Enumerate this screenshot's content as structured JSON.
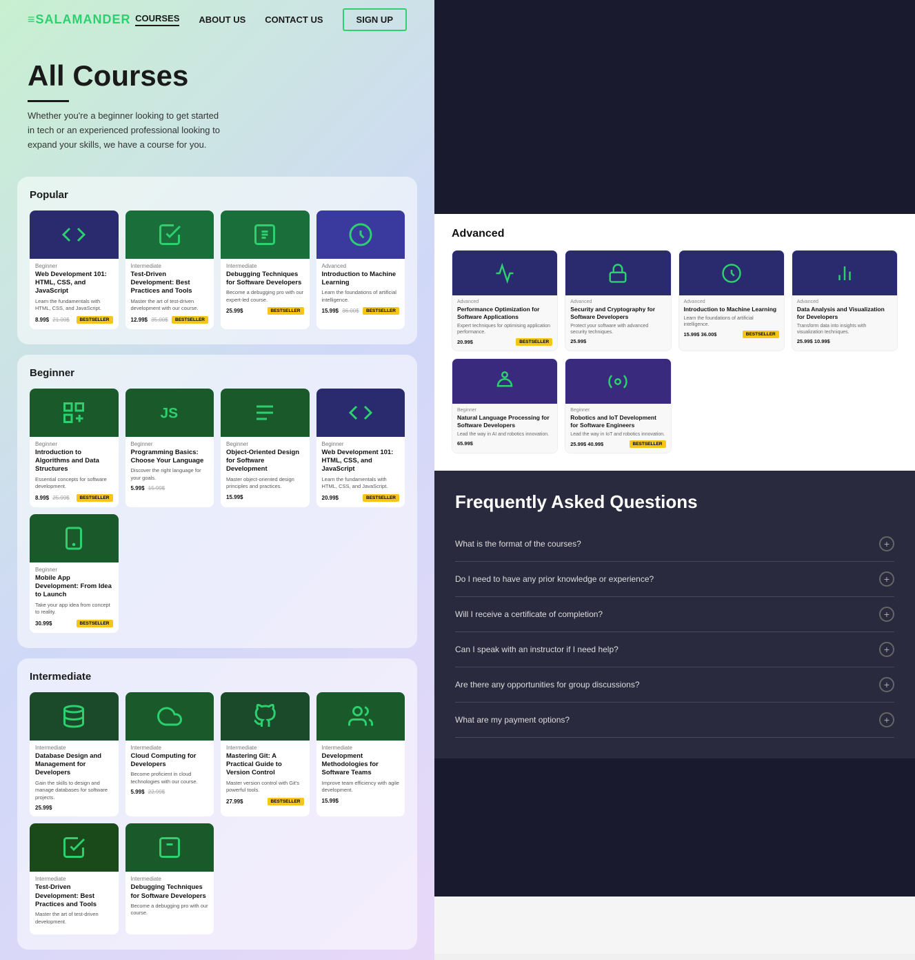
{
  "site": {
    "logo": "≡SALAMANDER",
    "logo_accent": "≡",
    "nav": {
      "courses": "COURSES",
      "about": "ABOUT US",
      "contact": "CONTACT US",
      "signup": "SIGN UP"
    }
  },
  "hero": {
    "title": "All Courses",
    "description": "Whether you're a beginner looking to get started in tech or an experienced professional looking to expand your skills, we have a course for you."
  },
  "popular": {
    "section_title": "Popular",
    "courses": [
      {
        "level": "Beginner",
        "title": "Web Development 101: HTML, CSS, and JavaScript",
        "desc": "Learn the fundamentals with HTML, CSS, and JavaScript.",
        "price": "8.99$",
        "old_price": "21.00$",
        "badge": "BESTSELLER",
        "thumb_color": "#1a3a1a"
      },
      {
        "level": "Intermediate",
        "title": "Test-Driven Development: Best Practices and Tools",
        "desc": "Master the art of test-driven development with our course.",
        "price": "12.99$",
        "old_price": "35.00$",
        "badge": "BESTSELLER",
        "thumb_color": "#1a4a1a"
      },
      {
        "level": "Intermediate",
        "title": "Debugging Techniques for Software Developers",
        "desc": "Become a debugging pro with our expert-led course.",
        "price": "25.99$",
        "old_price": "",
        "badge": "BESTSELLER",
        "thumb_color": "#1a4a1a"
      },
      {
        "level": "Advanced",
        "title": "Introduction to Machine Learning",
        "desc": "Learn the foundations of artificial intelligence.",
        "price": "15.99$",
        "old_price": "36.00$",
        "badge": "BESTSELLER",
        "thumb_color": "#2a2a7e"
      }
    ]
  },
  "beginner": {
    "section_title": "Beginner",
    "courses": [
      {
        "level": "Beginner",
        "title": "Introduction to Algorithms and Data Structures",
        "desc": "Essential concepts for software development.",
        "price": "8.99$",
        "old_price": "25.99$",
        "badge": "BESTSELLER",
        "thumb_color": "#1a4a1a"
      },
      {
        "level": "Beginner",
        "title": "Programming Basics: Choose Your Language",
        "desc": "Discover the right language for your goals.",
        "price": "5.99$",
        "old_price": "15.99$",
        "badge": "",
        "thumb_color": "#1a4a1a"
      },
      {
        "level": "Beginner",
        "title": "Object-Oriented Design for Software Development",
        "desc": "Master object-oriented design principles and practices.",
        "price": "15.99$",
        "old_price": "",
        "badge": "",
        "thumb_color": "#1a4a1a"
      },
      {
        "level": "Beginner",
        "title": "Web Development 101: HTML, CSS, and JavaScript",
        "desc": "Learn the fundamentals with HTML, CSS, and JavaScript.",
        "price": "20.99$",
        "old_price": "",
        "badge": "BESTSELLER",
        "thumb_color": "#1a3a1a"
      },
      {
        "level": "Beginner",
        "title": "Mobile App Development: From Idea to Launch",
        "desc": "Take your app idea from concept to reality.",
        "price": "30.99$",
        "old_price": "",
        "badge": "BESTSELLER",
        "thumb_color": "#1a4a1a"
      }
    ]
  },
  "intermediate": {
    "section_title": "Intermediate",
    "courses": [
      {
        "level": "Intermediate",
        "title": "Database Design and Management for Developers",
        "desc": "Gain the skills to design and manage databases for software projects.",
        "price": "25.99$",
        "old_price": "",
        "badge": "",
        "thumb_color": "#1a4a1a"
      },
      {
        "level": "Intermediate",
        "title": "Cloud Computing for Developers",
        "desc": "Become proficient in cloud technologies with our course.",
        "price": "5.99$",
        "old_price": "22.99$",
        "badge": "",
        "thumb_color": "#1a5a1a"
      },
      {
        "level": "Intermediate",
        "title": "Mastering Git: A Practical Guide to Version Control",
        "desc": "Master version control with Git's powerful tools.",
        "price": "27.99$",
        "old_price": "",
        "badge": "BESTSELLER",
        "thumb_color": "#1a4a1a"
      },
      {
        "level": "Intermediate",
        "title": "Development Methodologies for Software Teams",
        "desc": "Improve team efficiency with agile development.",
        "price": "15.99$",
        "old_price": "",
        "badge": "",
        "thumb_color": "#1a5a2a"
      },
      {
        "level": "Intermediate",
        "title": "Test-Driven Development: Best Practices and Tools",
        "desc": "Master the art of test-driven development.",
        "price": "",
        "old_price": "",
        "badge": "",
        "thumb_color": "#1a4a1a"
      },
      {
        "level": "Intermediate",
        "title": "Debugging Techniques for Software Developers",
        "desc": "Become a debugging pro with our course.",
        "price": "",
        "old_price": "",
        "badge": "",
        "thumb_color": "#1a5a2a"
      }
    ]
  },
  "advanced": {
    "section_title": "Advanced",
    "courses": [
      {
        "level": "Advanced",
        "title": "Performance Optimization for Software Applications",
        "desc": "Expert techniques for optimising application performance.",
        "price": "20.99$",
        "old_price": "",
        "badge": "BESTSELLER",
        "thumb_color": "#2a2a7e"
      },
      {
        "level": "Advanced",
        "title": "Security and Cryptography for Software Developers",
        "desc": "Protect your software with advanced security techniques.",
        "price": "25.99$",
        "old_price": "",
        "badge": "",
        "thumb_color": "#2a2a7e"
      },
      {
        "level": "Advanced",
        "title": "Introduction to Machine Learning",
        "desc": "Learn the foundations of artificial intelligence.",
        "price": "15.99$",
        "old_price": "36.00$",
        "badge": "BESTSELLER",
        "thumb_color": "#2a2a7e"
      },
      {
        "level": "Advanced",
        "title": "Data Analysis and Visualization for Developers",
        "desc": "Transform data into insights with visualization techniques.",
        "price": "25.99$",
        "old_price": "10.99$",
        "badge": "",
        "thumb_color": "#2a2a7e"
      },
      {
        "level": "Beginner",
        "title": "Natural Language Processing for Software Developers",
        "desc": "Lead the way in AI and robotics innovation.",
        "price": "65.99$",
        "old_price": "",
        "badge": "",
        "thumb_color": "#3a2a7e"
      },
      {
        "level": "Beginner",
        "title": "Robotics and IoT Development for Software Engineers",
        "desc": "Lead the way in IoT and robotics innovation.",
        "price": "25.99$",
        "old_price": "40.99$",
        "badge": "BESTSELLER",
        "thumb_color": "#3a2a7e"
      }
    ]
  },
  "faq": {
    "title": "Frequently Asked Questions",
    "questions": [
      "What is the format of the courses?",
      "Do I need to have any prior knowledge or experience?",
      "Will I receive a certificate of completion?",
      "Can I speak with an instructor if I need help?",
      "Are there any opportunities for group discussions?",
      "What are my payment options?"
    ]
  }
}
